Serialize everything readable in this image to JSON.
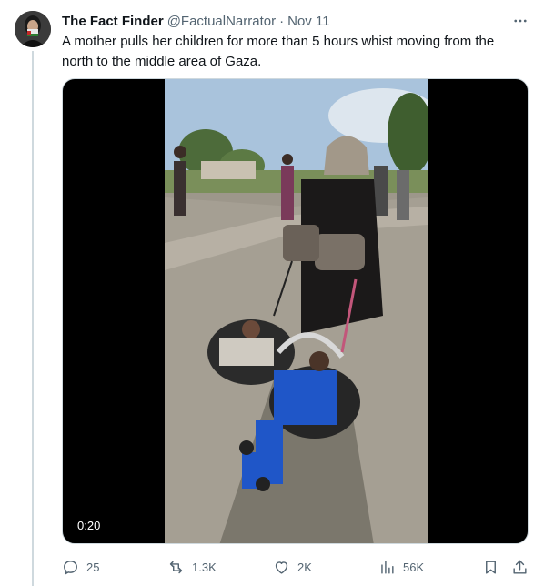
{
  "tweet": {
    "author_name": "The Fact Finder",
    "handle": "@FactualNarrator",
    "separator": "·",
    "date": "Nov 11",
    "text": "A mother pulls her children for more than 5 hours whist moving from the north to the middle area of Gaza.",
    "more_icon": "more-horizontal-icon"
  },
  "media": {
    "type": "video",
    "duration": "0:20"
  },
  "actions": {
    "reply_count": "25",
    "retweet_count": "1.3K",
    "like_count": "2K",
    "views_count": "56K",
    "bookmark_icon": "bookmark-icon",
    "share_icon": "share-icon"
  },
  "colors": {
    "text_primary": "#0f1419",
    "text_secondary": "#536471",
    "border": "#cfd9de"
  }
}
